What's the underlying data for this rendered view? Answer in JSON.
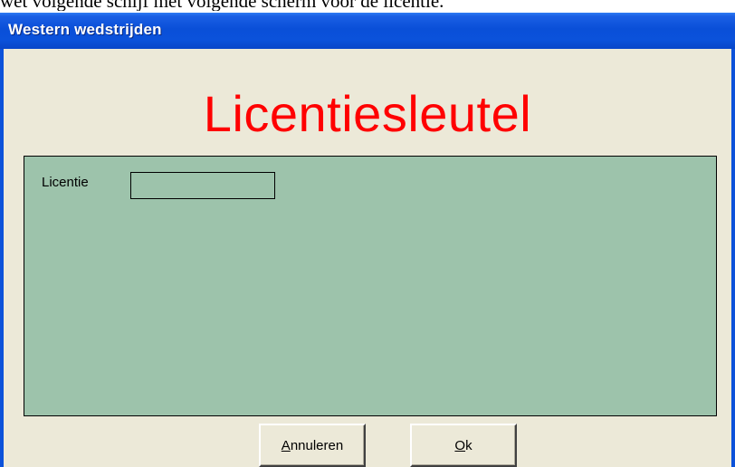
{
  "document": {
    "text_above": "wet volgende schijf met volgende scherm voor de licentie."
  },
  "window": {
    "title": "Western wedstrijden"
  },
  "heading": "Licentiesleutel",
  "form": {
    "license_label": "Licentie",
    "license_value": ""
  },
  "buttons": {
    "cancel": {
      "accel": "A",
      "rest": "nnuleren"
    },
    "ok": {
      "accel": "O",
      "rest": "k"
    }
  },
  "colors": {
    "titlebar": "#0a4fd8",
    "heading": "#ff0000",
    "panel": "#9dc3ab",
    "dialog": "#ece9d8"
  }
}
